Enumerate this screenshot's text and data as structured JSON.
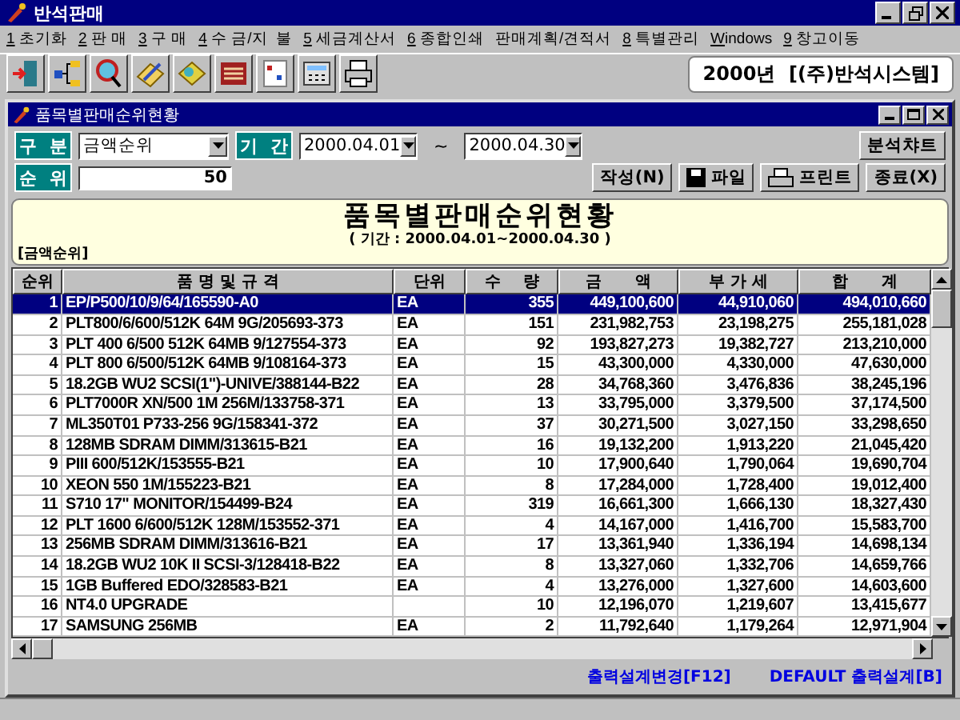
{
  "window": {
    "title": "반석판매"
  },
  "menu": [
    {
      "key": "1",
      "label": " 초기화"
    },
    {
      "key": "2",
      "label": " 판 매"
    },
    {
      "key": "3",
      "label": " 구 매"
    },
    {
      "key": "4",
      "label": " 수 금/지  불"
    },
    {
      "key": "5",
      "label": " 세금계산서"
    },
    {
      "key": "6",
      "label": " 종합인쇄"
    },
    {
      "label": "판매계획/견적서"
    },
    {
      "key": "8",
      "label": " 특별관리"
    },
    {
      "key": "W",
      "label": "indows"
    },
    {
      "key": "9",
      "label": " 창고이동"
    }
  ],
  "toolbar": {
    "company": "2000년  [(주)반석시스템]"
  },
  "child_window": {
    "title": "품목별판매순위현황"
  },
  "filters": {
    "type_label": "구  분",
    "type_value": "금액순위",
    "period_label": "기  간",
    "date_from": "2000.04.01",
    "tilde": "~",
    "date_to": "2000.04.30",
    "rank_label": "순  위",
    "rank_value": "50"
  },
  "buttons": {
    "chart": "분석챠트",
    "create": "작성(N)",
    "file": "파일",
    "print": "프린트",
    "close": "종료(X)"
  },
  "report": {
    "title": "품목별판매순위현황",
    "period": "( 기간 : 2000.04.01~2000.04.30 )",
    "subtitle": "[금액순위]"
  },
  "table": {
    "columns": [
      "순위",
      "품 명 및 규 격",
      "단위",
      "수    량",
      "금      액",
      "부 가 세",
      "합      계"
    ],
    "rows": [
      {
        "rank": "1",
        "name": "EP/P500/10/9/64/165590-A0",
        "unit": "EA",
        "qty": "355",
        "amount": "449,100,600",
        "vat": "44,910,060",
        "total": "494,010,660",
        "selected": true
      },
      {
        "rank": "2",
        "name": "PLT800/6/600/512K 64M 9G/205693-373",
        "unit": "EA",
        "qty": "151",
        "amount": "231,982,753",
        "vat": "23,198,275",
        "total": "255,181,028",
        "selected": false
      },
      {
        "rank": "3",
        "name": "PLT 400 6/500 512K 64MB 9/127554-373",
        "unit": "EA",
        "qty": "92",
        "amount": "193,827,273",
        "vat": "19,382,727",
        "total": "213,210,000",
        "selected": false
      },
      {
        "rank": "4",
        "name": "PLT 800 6/500/512K 64MB 9/108164-373",
        "unit": "EA",
        "qty": "15",
        "amount": "43,300,000",
        "vat": "4,330,000",
        "total": "47,630,000",
        "selected": false
      },
      {
        "rank": "5",
        "name": "18.2GB WU2 SCSI(1\")-UNIVE/388144-B22",
        "unit": "EA",
        "qty": "28",
        "amount": "34,768,360",
        "vat": "3,476,836",
        "total": "38,245,196",
        "selected": false
      },
      {
        "rank": "6",
        "name": "PLT7000R XN/500 1M 256M/133758-371",
        "unit": "EA",
        "qty": "13",
        "amount": "33,795,000",
        "vat": "3,379,500",
        "total": "37,174,500",
        "selected": false
      },
      {
        "rank": "7",
        "name": "ML350T01 P733-256 9G/158341-372",
        "unit": "EA",
        "qty": "37",
        "amount": "30,271,500",
        "vat": "3,027,150",
        "total": "33,298,650",
        "selected": false
      },
      {
        "rank": "8",
        "name": "128MB SDRAM DIMM/313615-B21",
        "unit": "EA",
        "qty": "16",
        "amount": "19,132,200",
        "vat": "1,913,220",
        "total": "21,045,420",
        "selected": false
      },
      {
        "rank": "9",
        "name": "PIII 600/512K/153555-B21",
        "unit": "EA",
        "qty": "10",
        "amount": "17,900,640",
        "vat": "1,790,064",
        "total": "19,690,704",
        "selected": false
      },
      {
        "rank": "10",
        "name": "XEON 550 1M/155223-B21",
        "unit": "EA",
        "qty": "8",
        "amount": "17,284,000",
        "vat": "1,728,400",
        "total": "19,012,400",
        "selected": false
      },
      {
        "rank": "11",
        "name": "S710 17\" MONITOR/154499-B24",
        "unit": "EA",
        "qty": "319",
        "amount": "16,661,300",
        "vat": "1,666,130",
        "total": "18,327,430",
        "selected": false
      },
      {
        "rank": "12",
        "name": "PLT 1600 6/600/512K 128M/153552-371",
        "unit": "EA",
        "qty": "4",
        "amount": "14,167,000",
        "vat": "1,416,700",
        "total": "15,583,700",
        "selected": false
      },
      {
        "rank": "13",
        "name": "256MB SDRAM DIMM/313616-B21",
        "unit": "EA",
        "qty": "17",
        "amount": "13,361,940",
        "vat": "1,336,194",
        "total": "14,698,134",
        "selected": false
      },
      {
        "rank": "14",
        "name": "18.2GB WU2 10K II SCSI-3/128418-B22",
        "unit": "EA",
        "qty": "8",
        "amount": "13,327,060",
        "vat": "1,332,706",
        "total": "14,659,766",
        "selected": false
      },
      {
        "rank": "15",
        "name": "1GB Buffered EDO/328583-B21",
        "unit": "EA",
        "qty": "4",
        "amount": "13,276,000",
        "vat": "1,327,600",
        "total": "14,603,600",
        "selected": false
      },
      {
        "rank": "16",
        "name": "NT4.0 UPGRADE",
        "qty": "10",
        "amount": "12,196,070",
        "vat": "1,219,607",
        "total": "13,415,677",
        "selected": false
      },
      {
        "rank": "17",
        "name": "SAMSUNG 256MB",
        "unit": "EA",
        "qty": "2",
        "amount": "11,792,640",
        "vat": "1,179,264",
        "total": "12,971,904",
        "selected": false
      }
    ]
  },
  "links": [
    "출력설계변경[F12]",
    "DEFAULT 출력설계[B]"
  ]
}
